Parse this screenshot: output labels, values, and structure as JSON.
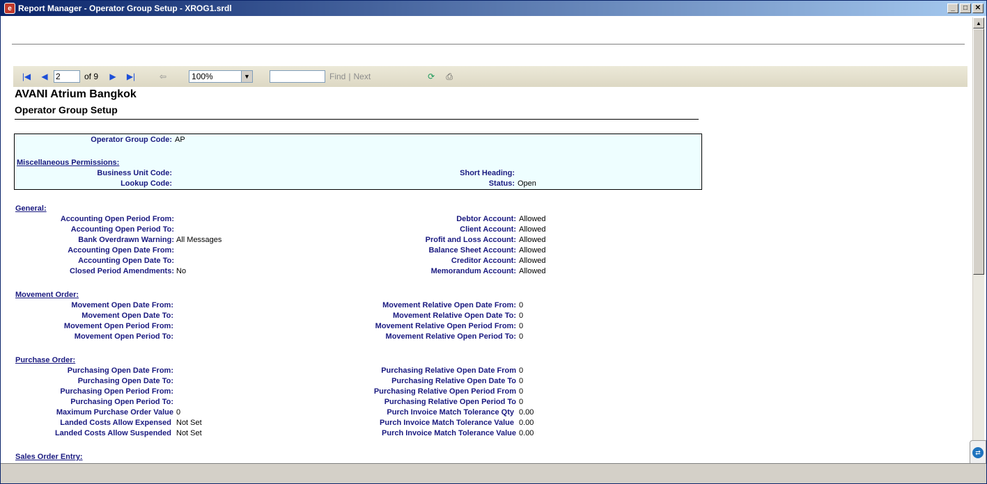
{
  "window": {
    "title": "Report Manager - Operator Group Setup - XROG1.srdl"
  },
  "toolbar": {
    "page_current": "2",
    "page_total": "of 9",
    "zoom": "100%",
    "find_label": "Find",
    "separator": "|",
    "next_label": "Next"
  },
  "report": {
    "hotel": "AVANI Atrium Bangkok",
    "title": "Operator Group Setup",
    "header_box": {
      "group_code_label": "Operator Group Code:",
      "group_code_value": "AP",
      "misc_heading": "Miscellaneous Permissions:",
      "business_unit_label": "Business Unit Code:",
      "business_unit_value": "",
      "short_heading_label": "Short Heading:",
      "short_heading_value": "",
      "lookup_label": "Lookup Code:",
      "lookup_value": "",
      "status_label": "Status:",
      "status_value": "Open"
    },
    "general": {
      "heading": "General:",
      "left": [
        {
          "label": "Accounting Open Period From:",
          "value": ""
        },
        {
          "label": "Accounting Open Period To:",
          "value": ""
        },
        {
          "label": "Bank Overdrawn Warning:",
          "value": "All Messages"
        },
        {
          "label": "Accounting Open Date From:",
          "value": ""
        },
        {
          "label": "Accounting Open Date To:",
          "value": ""
        },
        {
          "label": "Closed Period Amendments:",
          "value": "No"
        }
      ],
      "right": [
        {
          "label": "Debtor Account:",
          "value": "Allowed"
        },
        {
          "label": "Client Account:",
          "value": "Allowed"
        },
        {
          "label": "Profit and Loss Account:",
          "value": "Allowed"
        },
        {
          "label": "Balance Sheet Account:",
          "value": "Allowed"
        },
        {
          "label": "Creditor Account:",
          "value": "Allowed"
        },
        {
          "label": "Memorandum Account:",
          "value": "Allowed"
        }
      ]
    },
    "movement": {
      "heading": "Movement Order:",
      "left": [
        {
          "label": "Movement Open Date From:",
          "value": ""
        },
        {
          "label": "Movement Open Date To:",
          "value": ""
        },
        {
          "label": "Movement Open Period From:",
          "value": ""
        },
        {
          "label": "Movement Open Period To:",
          "value": ""
        }
      ],
      "right": [
        {
          "label": "Movement Relative Open Date From:",
          "value": "0"
        },
        {
          "label": "Movement Relative Open Date To:",
          "value": "0"
        },
        {
          "label": "Movement Relative Open Period From:",
          "value": "0"
        },
        {
          "label": "Movement Relative Open Period To:",
          "value": "0"
        }
      ]
    },
    "purchase": {
      "heading": "Purchase Order:",
      "left": [
        {
          "label": "Purchasing Open Date From:",
          "value": ""
        },
        {
          "label": "Purchasing Open Date To:",
          "value": ""
        },
        {
          "label": "Purchasing Open Period From:",
          "value": ""
        },
        {
          "label": "Purchasing Open Period To:",
          "value": ""
        },
        {
          "label": "Maximum Purchase Order Value",
          "value": "0"
        },
        {
          "label": "Landed Costs Allow Expensed",
          "value": "Not Set"
        },
        {
          "label": "Landed Costs Allow Suspended",
          "value": "Not Set"
        }
      ],
      "right": [
        {
          "label": "Purchasing Relative Open Date From",
          "value": "0"
        },
        {
          "label": "Purchasing Relative Open Date To",
          "value": "0"
        },
        {
          "label": "Purchasing Relative Open Period From",
          "value": "0"
        },
        {
          "label": "Purchasing Relative Open Period To",
          "value": "0"
        },
        {
          "label": "Purch Invoice Match Tolerance Qty",
          "value": "0.00"
        },
        {
          "label": "Purch Invoice Match Tolerance Value",
          "value": "0.00"
        },
        {
          "label": "Purch Invoice Match Tolerance Value",
          "value": "0.00"
        }
      ]
    },
    "sales": {
      "heading": "Sales Order Entry:"
    }
  }
}
